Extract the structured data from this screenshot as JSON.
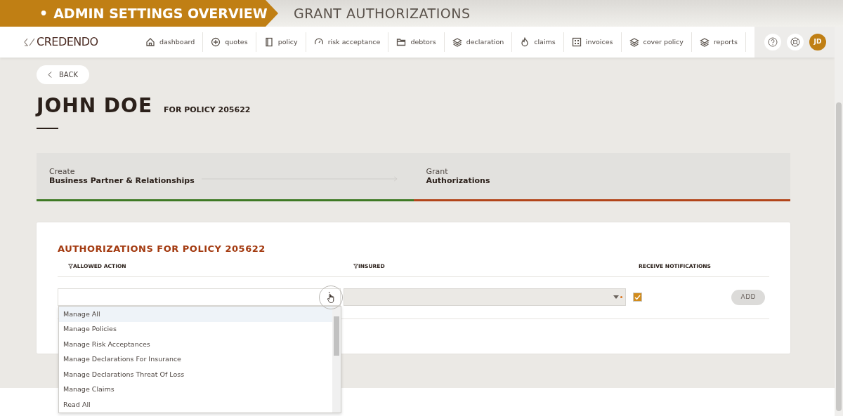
{
  "banner": {
    "bullet": "•",
    "section": "ADMIN SETTINGS OVERVIEW",
    "page": "GRANT AUTHORIZATIONS"
  },
  "brand": "CREDENDO",
  "nav": [
    {
      "kind": "home",
      "label": "dashboard"
    },
    {
      "kind": "plus",
      "label": "quotes"
    },
    {
      "kind": "book",
      "label": "policy"
    },
    {
      "kind": "gauge",
      "label": "risk acceptance"
    },
    {
      "kind": "folder",
      "label": "debtors"
    },
    {
      "kind": "layers",
      "label": "declaration"
    },
    {
      "kind": "flame",
      "label": "claims"
    },
    {
      "kind": "grid",
      "label": "invoices"
    },
    {
      "kind": "layers",
      "label": "cover policy"
    },
    {
      "kind": "layers",
      "label": "reports"
    }
  ],
  "user": {
    "initials": "JD"
  },
  "back": "BACK",
  "title": "JOHN DOE",
  "subtitle": "FOR POLICY 205622",
  "steps": [
    {
      "label": "Create",
      "title": "Business Partner & Relationships",
      "kind": "done"
    },
    {
      "label": "Grant",
      "title": "Authorizations",
      "kind": "current"
    }
  ],
  "card": {
    "title": "AUTHORIZATIONS FOR POLICY 205622",
    "columns": [
      {
        "label": "ALLOWED ACTION",
        "filter": true
      },
      {
        "label": "INSURED",
        "filter": true
      },
      {
        "label": "RECEIVE NOTIFICATIONS",
        "filter": false
      }
    ],
    "allowed_action": {
      "expanded": true,
      "options": [
        {
          "label": "Manage All",
          "selected": true
        },
        {
          "label": "Manage Policies",
          "selected": false
        },
        {
          "label": "Manage Risk Acceptances",
          "selected": false
        },
        {
          "label": "Manage Declarations For Insurance",
          "selected": false
        },
        {
          "label": "Manage Declarations Threat Of Loss",
          "selected": false
        },
        {
          "label": "Manage Claims",
          "selected": false
        },
        {
          "label": "Read All",
          "selected": false
        }
      ]
    },
    "insured": {
      "disabled": true
    },
    "notifications": {
      "checked": true
    },
    "add": {
      "label": "ADD",
      "disabled": true
    }
  }
}
